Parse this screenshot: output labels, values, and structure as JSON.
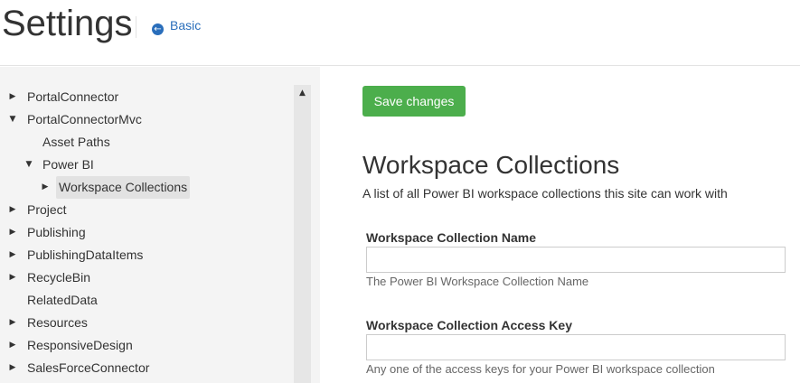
{
  "header": {
    "title": "Settings",
    "basic_link": "Basic",
    "basic_icon": "arrow-left-circle-icon"
  },
  "sidebar": {
    "items": [
      {
        "label": "PortalConnector",
        "toggle": "▶",
        "level": 0
      },
      {
        "label": "PortalConnectorMvc",
        "toggle": "▼",
        "level": 0
      },
      {
        "label": "Asset Paths",
        "toggle": "",
        "level": 1
      },
      {
        "label": "Power BI",
        "toggle": "▼",
        "level": 1
      },
      {
        "label": "Workspace Collections",
        "toggle": "▶",
        "level": 2,
        "selected": true
      },
      {
        "label": "Project",
        "toggle": "▶",
        "level": 0
      },
      {
        "label": "Publishing",
        "toggle": "▶",
        "level": 0
      },
      {
        "label": "PublishingDataItems",
        "toggle": "▶",
        "level": 0
      },
      {
        "label": "RecycleBin",
        "toggle": "▶",
        "level": 0
      },
      {
        "label": "RelatedData",
        "toggle": "",
        "level": 0
      },
      {
        "label": "Resources",
        "toggle": "▶",
        "level": 0
      },
      {
        "label": "ResponsiveDesign",
        "toggle": "▶",
        "level": 0
      },
      {
        "label": "SalesForceConnector",
        "toggle": "▶",
        "level": 0
      }
    ],
    "scroll_up_icon": "▲"
  },
  "main": {
    "save_label": "Save changes",
    "section_title": "Workspace Collections",
    "section_description": "A list of all Power BI workspace collections this site can work with",
    "fields": [
      {
        "label": "Workspace Collection Name",
        "value": "",
        "help": "The Power BI Workspace Collection Name"
      },
      {
        "label": "Workspace Collection Access Key",
        "value": "",
        "help": "Any one of the access keys for your Power BI workspace collection"
      }
    ]
  },
  "colors": {
    "accent_link": "#2a6ebb",
    "save_button": "#4cae4c",
    "sidebar_bg": "#f4f4f4",
    "selected_bg": "#e2e2e2"
  }
}
